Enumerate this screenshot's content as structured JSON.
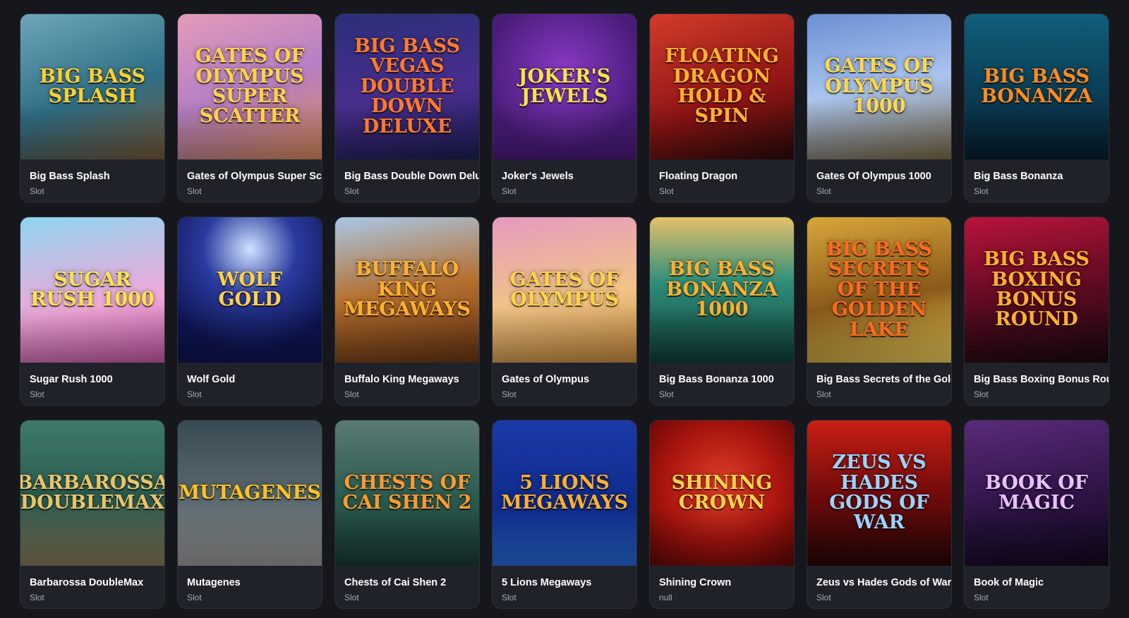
{
  "games": [
    {
      "name": "Big Bass Splash",
      "type": "Slot",
      "art": "BIG BASS SPLASH",
      "bg": "linear-gradient(160deg,#6fa6b8,#2f6f86 55%,#7a5a3a)",
      "fg": "#ffcf2e"
    },
    {
      "name": "Gates of Olympus Super Sca",
      "type": "Slot",
      "art": "GATES OF OLYMPUS SUPER SCATTER",
      "bg": "linear-gradient(160deg,#e39bb8,#b77fc4 50%,#d88a5a)",
      "fg": "#ffd24a"
    },
    {
      "name": "Big Bass Double Down Delux",
      "type": "Slot",
      "art": "BIG BASS VEGAS DOUBLE DOWN DELUXE",
      "bg": "linear-gradient(170deg,#2a2f7a,#4a2e8e 55%,#1b1e55)",
      "fg": "#ff7a2a"
    },
    {
      "name": "Joker's Jewels",
      "type": "Slot",
      "art": "JOKER'S JEWELS",
      "bg": "radial-gradient(circle at 50% 40%,#8b3ac7,#4a1c7a 70%)",
      "fg": "#f5e34a"
    },
    {
      "name": "Floating Dragon",
      "type": "Slot",
      "art": "FLOATING DRAGON HOLD & SPIN",
      "bg": "linear-gradient(160deg,#d23b2a,#8e1414 60%,#2a0a0a)",
      "fg": "#ffb02e"
    },
    {
      "name": "Gates Of Olympus 1000",
      "type": "Slot",
      "art": "GATES OF OLYMPUS 1000",
      "bg": "linear-gradient(170deg,#6b8fd4,#a9c4ee 50%,#7c6a48)",
      "fg": "#ffd84a"
    },
    {
      "name": "Big Bass Bonanza",
      "type": "Slot",
      "art": "BIG BASS BONANZA",
      "bg": "linear-gradient(180deg,#0f5e7a,#0a3a52 60%,#061f2e)",
      "fg": "#ff8a1e"
    },
    {
      "name": "Sugar Rush 1000",
      "type": "Slot",
      "art": "SUGAR RUSH 1000",
      "bg": "linear-gradient(170deg,#8fd4f0,#f0a8d8 60%,#c95aa8)",
      "fg": "#ffe24a"
    },
    {
      "name": "Wolf Gold",
      "type": "Slot",
      "art": "WOLF GOLD",
      "bg": "radial-gradient(circle at 50% 22%,#cfe2ff,#2a3a9e 35%,#0e1452 75%)",
      "fg": "#ffd24a"
    },
    {
      "name": "Buffalo King Megaways",
      "type": "Slot",
      "art": "BUFFALO KING MEGAWAYS",
      "bg": "linear-gradient(170deg,#a9c8e6,#b5702f 50%,#6a3514)",
      "fg": "#ffb02e"
    },
    {
      "name": "Gates of Olympus",
      "type": "Slot",
      "art": "GATES OF OLYMPUS",
      "bg": "linear-gradient(170deg,#e59ac0,#f1c487 55%,#c88c3a)",
      "fg": "#ffd24a"
    },
    {
      "name": "Big Bass Bonanza 1000",
      "type": "Slot",
      "art": "BIG BASS BONANZA 1000",
      "bg": "linear-gradient(180deg,#e6c06a,#2e8e7a 45%,#0f3e3a)",
      "fg": "#ffb02e"
    },
    {
      "name": "Big Bass Secrets of the Golde",
      "type": "Slot",
      "art": "BIG BASS SECRETS OF THE GOLDEN LAKE",
      "bg": "linear-gradient(170deg,#d8a63a,#8a5a1a 55%,#f2d25a)",
      "fg": "#ff6a1e"
    },
    {
      "name": "Big Bass Boxing Bonus Round",
      "type": "Slot",
      "art": "BIG BASS BOXING BONUS ROUND",
      "bg": "linear-gradient(170deg,#b8143a,#5a0a20 55%,#1a0810)",
      "fg": "#ffb02e"
    },
    {
      "name": "Barbarossa DoubleMax",
      "type": "Slot",
      "art": "BARBAROSSA DOUBLEMAX",
      "bg": "linear-gradient(180deg,#3e7a6a,#2a5a4e 55%,#8a7a5a)",
      "fg": "#e9c46a"
    },
    {
      "name": "Mutagenes",
      "type": "Slot",
      "art": "MUTAGENES",
      "bg": "linear-gradient(180deg,#3a4a52,#5a6a70 55%,#9a9a9a)",
      "fg": "#ffc21e"
    },
    {
      "name": "Chests of Cai Shen 2",
      "type": "Slot",
      "art": "CHESTS OF CAI SHEN 2",
      "bg": "linear-gradient(180deg,#5a7a72,#2a5a4e 55%,#1a3a34)",
      "fg": "#ff9a2e"
    },
    {
      "name": "5 Lions Megaways",
      "type": "Slot",
      "art": "5 LIONS MEGAWAYS",
      "bg": "linear-gradient(180deg,#1a3aa8,#0e2a8a 60%,#2a6ad8)",
      "fg": "#ffb02e"
    },
    {
      "name": "Shining Crown",
      "type": "null",
      "art": "SHINING CROWN",
      "bg": "radial-gradient(circle at 50% 45%,#e0402a,#a8140e 55%,#5a0606)",
      "fg": "#ffd24a"
    },
    {
      "name": "Zeus vs Hades Gods of War",
      "type": "Slot",
      "art": "ZEUS VS HADES GODS OF WAR",
      "bg": "linear-gradient(180deg,#c81e14,#6a0a0a 55%,#2a0606)",
      "fg": "#9ad4ff"
    },
    {
      "name": "Book of Magic",
      "type": "Slot",
      "art": "BOOK OF MAGIC",
      "bg": "linear-gradient(170deg,#5a2a7a,#2a1242 60%,#14081e)",
      "fg": "#e9c0ff"
    }
  ]
}
